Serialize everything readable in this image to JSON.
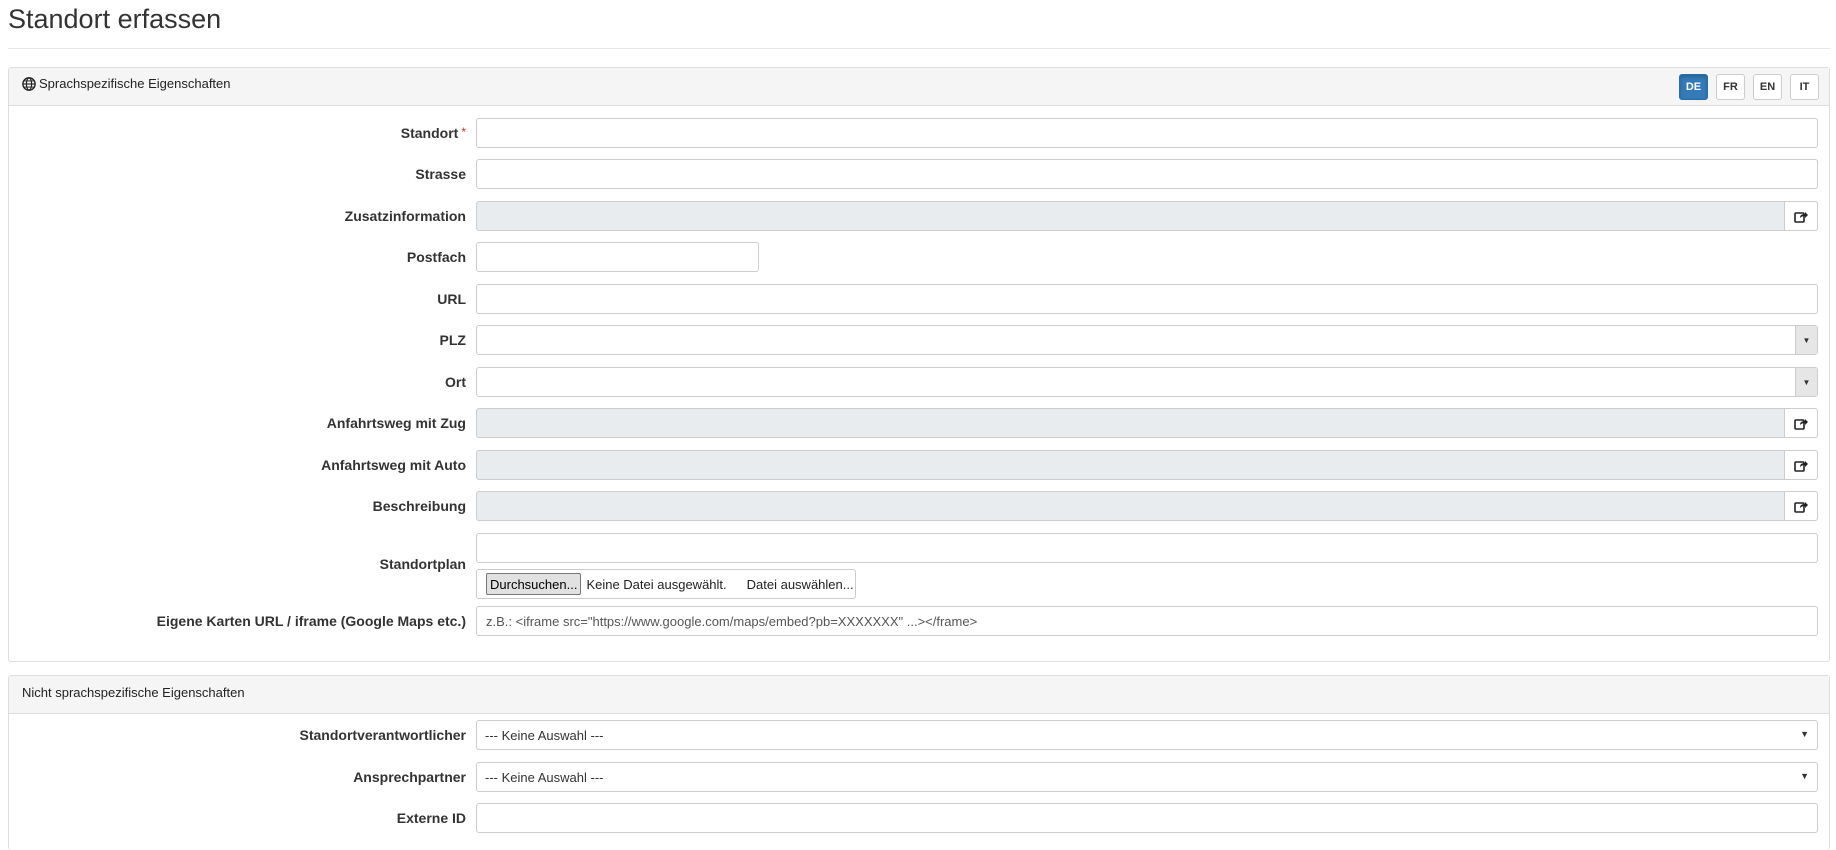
{
  "page": {
    "title": "Standort erfassen"
  },
  "section1": {
    "heading": "Sprachspezifische Eigenschaften",
    "languages": [
      {
        "label": "DE",
        "active": true
      },
      {
        "label": "FR",
        "active": false
      },
      {
        "label": "EN",
        "active": false
      },
      {
        "label": "IT",
        "active": false
      }
    ],
    "fields": {
      "standort": {
        "label": "Standort",
        "required_marker": "*",
        "value": ""
      },
      "strasse": {
        "label": "Strasse",
        "value": ""
      },
      "zusatzinformation": {
        "label": "Zusatzinformation",
        "value": ""
      },
      "postfach": {
        "label": "Postfach",
        "value": ""
      },
      "url": {
        "label": "URL",
        "value": ""
      },
      "plz": {
        "label": "PLZ",
        "value": ""
      },
      "ort": {
        "label": "Ort",
        "value": ""
      },
      "anfahrt_zug": {
        "label": "Anfahrtsweg mit Zug",
        "value": ""
      },
      "anfahrt_auto": {
        "label": "Anfahrtsweg mit Auto",
        "value": ""
      },
      "beschreibung": {
        "label": "Beschreibung",
        "value": ""
      },
      "standortplan": {
        "label": "Standortplan",
        "browse_label": "Durchsuchen...",
        "file_status": "Keine Datei ausgewählt.",
        "choose_label": "Datei auswählen..."
      },
      "karten_url": {
        "label": "Eigene Karten URL / iframe (Google Maps etc.)",
        "placeholder": "z.B.: <iframe src=\"https://www.google.com/maps/embed?pb=XXXXXXX\" ...></frame>"
      }
    }
  },
  "section2": {
    "heading": "Nicht sprachspezifische Eigenschaften",
    "fields": {
      "verantwortlicher": {
        "label": "Standortverantwortlicher",
        "selected": "--- Keine Auswahl ---"
      },
      "ansprechpartner": {
        "label": "Ansprechpartner",
        "selected": "--- Keine Auswahl ---"
      },
      "externe_id": {
        "label": "Externe ID",
        "value": ""
      }
    }
  },
  "icons": {
    "globe": "globe-icon",
    "share": "share-icon",
    "dropdown": "caret-down-icon"
  },
  "colors": {
    "active_language": "#337ab7",
    "required": "#c9302c",
    "disabled_field": "#e9ecef"
  }
}
